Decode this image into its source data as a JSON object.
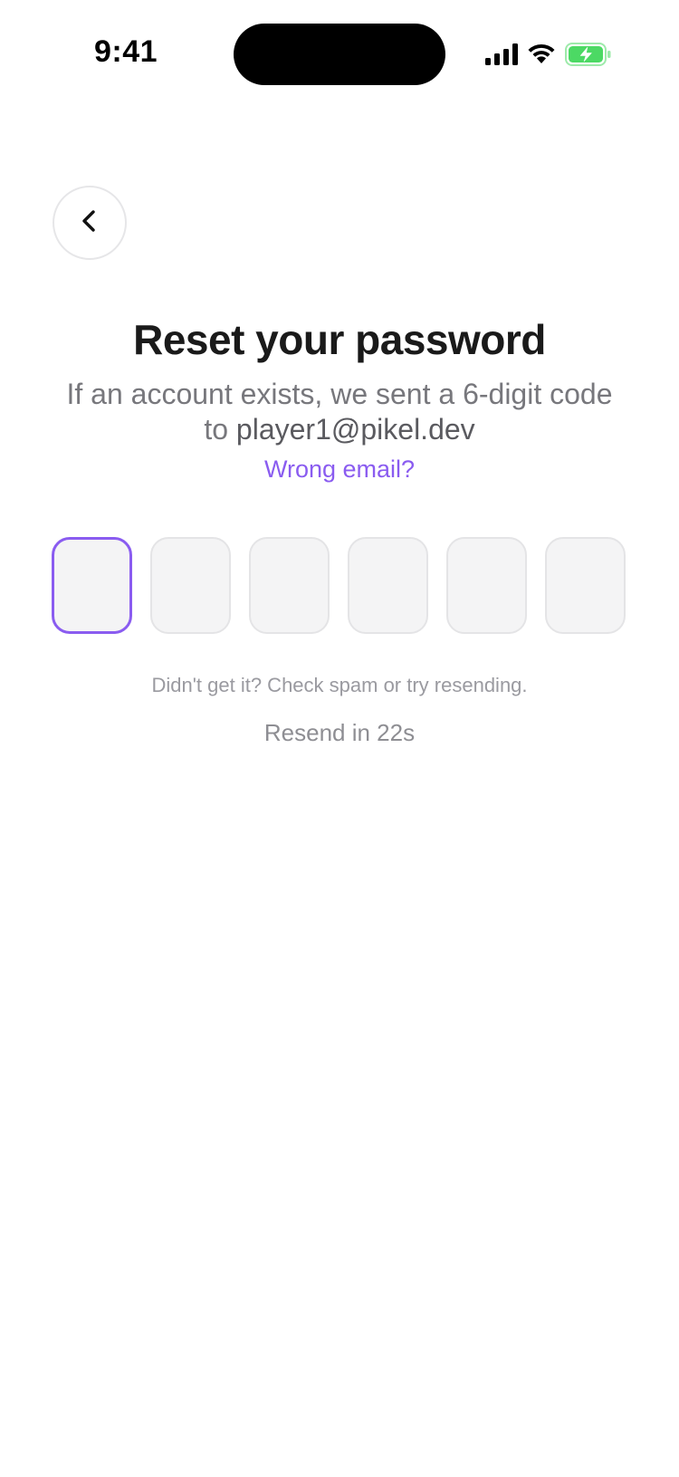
{
  "status_bar": {
    "time": "9:41",
    "icons": [
      "cellular-signal-icon",
      "wifi-icon",
      "battery-charging-icon"
    ],
    "battery_color": "#4cd964"
  },
  "header": {
    "back_icon": "chevron-left-icon"
  },
  "main": {
    "title": "Reset your password",
    "subtitle_prefix": "If an account exists, we sent a 6-digit code to ",
    "email": "player1@pikel.dev",
    "wrong_email_link": "Wrong email?",
    "otp": {
      "length": 6,
      "values": [
        "",
        "",
        "",
        "",
        "",
        ""
      ],
      "active_index": 0
    },
    "hint": "Didn't get it? Check spam or try resending.",
    "resend_label": "Resend in 22s"
  },
  "colors": {
    "accent": "#8a5cf0",
    "text_primary": "#1a1a1a",
    "text_secondary": "#77777c",
    "input_bg": "#f4f4f5"
  }
}
